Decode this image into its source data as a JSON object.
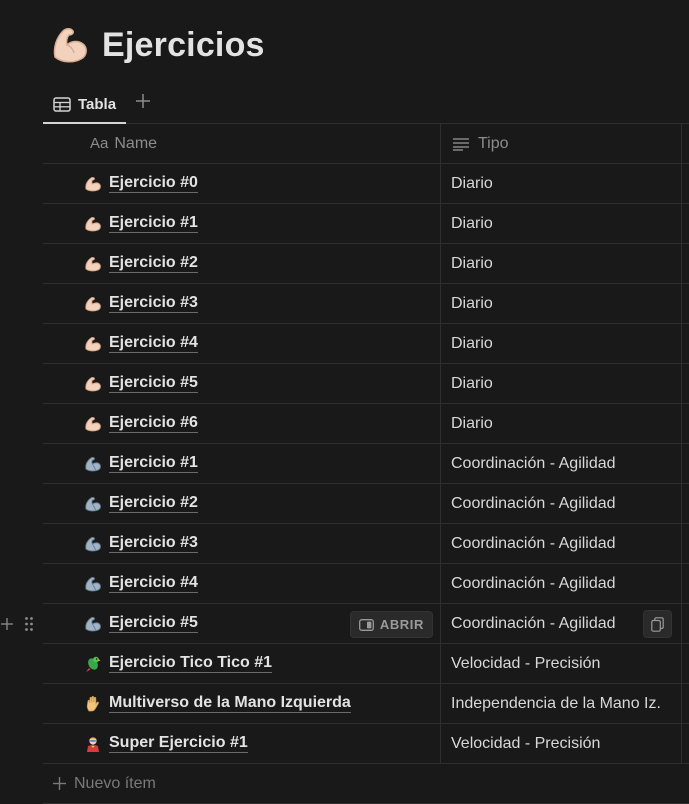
{
  "page": {
    "title": "Ejercicios",
    "icon": "flexed-biceps-icon"
  },
  "views": {
    "tabs": [
      {
        "label": "Tabla",
        "icon": "table-icon"
      }
    ],
    "add_icon": "plus-icon"
  },
  "table": {
    "columns": [
      {
        "label": "Name",
        "prefix": "Aa"
      },
      {
        "label": "Tipo",
        "icon": "text-lines-icon"
      }
    ],
    "rows": [
      {
        "icon": "flexed-biceps-light",
        "name": "Ejercicio #0",
        "tipo": "Diario"
      },
      {
        "icon": "flexed-biceps-light",
        "name": "Ejercicio #1",
        "tipo": "Diario"
      },
      {
        "icon": "flexed-biceps-light",
        "name": "Ejercicio #2",
        "tipo": "Diario"
      },
      {
        "icon": "flexed-biceps-light",
        "name": "Ejercicio #3",
        "tipo": "Diario"
      },
      {
        "icon": "flexed-biceps-light",
        "name": "Ejercicio #4",
        "tipo": "Diario"
      },
      {
        "icon": "flexed-biceps-light",
        "name": "Ejercicio #5",
        "tipo": "Diario"
      },
      {
        "icon": "flexed-biceps-light",
        "name": "Ejercicio #6",
        "tipo": "Diario"
      },
      {
        "icon": "mechanical-arm",
        "name": "Ejercicio #1",
        "tipo": "Coordinación - Agilidad"
      },
      {
        "icon": "mechanical-arm",
        "name": "Ejercicio #2",
        "tipo": "Coordinación - Agilidad"
      },
      {
        "icon": "mechanical-arm",
        "name": "Ejercicio #3",
        "tipo": "Coordinación - Agilidad"
      },
      {
        "icon": "mechanical-arm",
        "name": "Ejercicio #4",
        "tipo": "Coordinación - Agilidad"
      },
      {
        "icon": "mechanical-arm",
        "name": "Ejercicio #5",
        "tipo": "Coordinación - Agilidad",
        "hovered": true
      },
      {
        "icon": "parrot",
        "name": "Ejercicio Tico Tico #1",
        "tipo": "Velocidad - Precisión"
      },
      {
        "icon": "raised-hand",
        "name": "Multiverso de la Mano Izquierda",
        "tipo": "Independencia de la Mano Iz."
      },
      {
        "icon": "superhero",
        "name": "Super Ejercicio #1",
        "tipo": "Velocidad - Precisión"
      }
    ],
    "open_label": "ABRIR",
    "new_item_label": "Nuevo ítem"
  },
  "colors": {
    "background": "#191919",
    "text": "#d4d4d4",
    "border": "#2f2f2f",
    "muted": "#8c8c8c"
  }
}
